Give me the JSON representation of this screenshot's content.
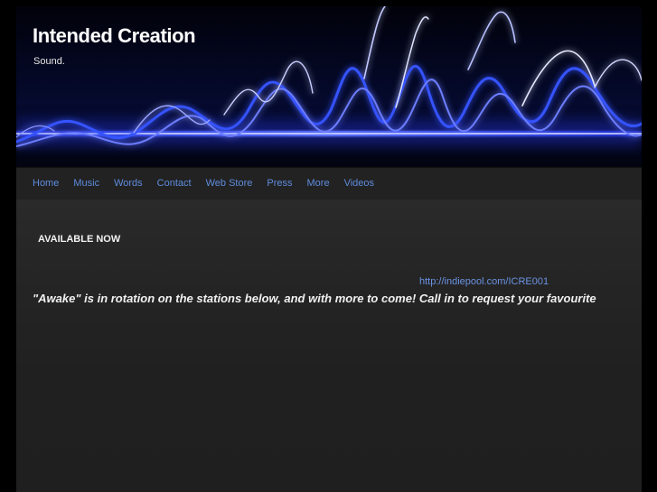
{
  "site": {
    "title": "Intended Creation",
    "description": "Sound."
  },
  "nav": {
    "items": [
      {
        "label": "Home",
        "name": "nav-home"
      },
      {
        "label": "Music",
        "name": "nav-music"
      },
      {
        "label": "Words",
        "name": "nav-words"
      },
      {
        "label": "Contact",
        "name": "nav-contact"
      },
      {
        "label": "Web Store",
        "name": "nav-web-store"
      },
      {
        "label": "Press",
        "name": "nav-press"
      },
      {
        "label": "More",
        "name": "nav-more"
      },
      {
        "label": "Videos",
        "name": "nav-videos"
      }
    ]
  },
  "content": {
    "heading": "AVAILABLE NOW",
    "link_text": "http://indiepool.com/ICRE001",
    "bottom_text": "\"Awake\" is in rotation on the stations below, and with more to come!  Call in to request your favourite"
  },
  "colors": {
    "background": "#000000",
    "page": "#222222",
    "link": "#5f8cde",
    "header_glow": "#3a52ff"
  }
}
